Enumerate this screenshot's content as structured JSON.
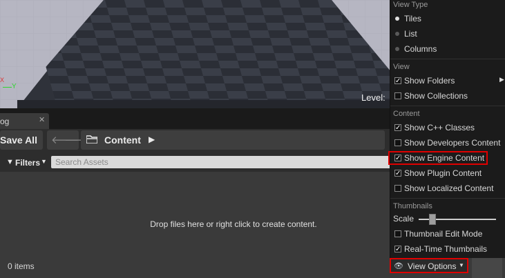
{
  "viewport": {
    "level_label": "Level:",
    "axis_y": "Y",
    "axis_x": "X"
  },
  "tab": {
    "label": "og",
    "close": "✕"
  },
  "toolbar": {
    "save_all": "Save All",
    "back_icon": "arrow-left-icon",
    "forward_icon": "arrow-right-icon",
    "path": "Content"
  },
  "filters": {
    "label": "Filters",
    "search_placeholder": "Search Assets"
  },
  "body": {
    "drop_hint": "Drop files here or right click to create content.",
    "item_count": "0 items"
  },
  "menu": {
    "view_type": {
      "heading": "View Type",
      "options": [
        {
          "label": "Tiles",
          "selected": true
        },
        {
          "label": "List",
          "selected": false
        },
        {
          "label": "Columns",
          "selected": false
        }
      ]
    },
    "view": {
      "heading": "View",
      "items": [
        {
          "label": "Show Folders",
          "checked": true,
          "submenu": true
        },
        {
          "label": "Show Collections",
          "checked": false
        }
      ]
    },
    "content": {
      "heading": "Content",
      "items": [
        {
          "label": "Show C++ Classes",
          "checked": true
        },
        {
          "label": "Show Developers Content",
          "checked": false
        },
        {
          "label": "Show Engine Content",
          "checked": true
        },
        {
          "label": "Show Plugin Content",
          "checked": true
        },
        {
          "label": "Show Localized Content",
          "checked": false
        }
      ]
    },
    "thumbnails": {
      "heading": "Thumbnails",
      "scale_label": "Scale",
      "scale_value": 0.14,
      "items": [
        {
          "label": "Thumbnail Edit Mode",
          "checked": false
        },
        {
          "label": "Real-Time Thumbnails",
          "checked": true
        }
      ]
    }
  },
  "view_options": {
    "label": "View Options",
    "icon": "eye-icon"
  },
  "colors": {
    "highlight": "#e00000",
    "menu_bg": "#1b1b1b",
    "panel_bg": "#3a3a3a"
  }
}
